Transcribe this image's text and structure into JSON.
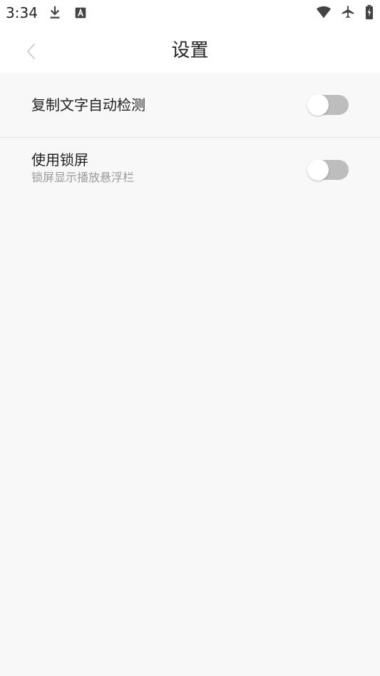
{
  "status_bar": {
    "time": "3:34",
    "left_icons": [
      "download-icon",
      "font-icon"
    ],
    "right_icons": [
      "wifi-icon",
      "airplane-icon",
      "battery-icon"
    ]
  },
  "header": {
    "title": "设置",
    "back_icon": "chevron-left-icon"
  },
  "settings": [
    {
      "label": "复制文字自动检测",
      "subtitle": "",
      "enabled": false
    },
    {
      "label": "使用锁屏",
      "subtitle": "锁屏显示播放悬浮栏",
      "enabled": false
    }
  ],
  "colors": {
    "background": "#f8f8f8",
    "toggle_track_off": "#bdbdbd",
    "toggle_knob": "#ffffff",
    "subtitle": "#9a9a9a",
    "divider": "#e3e3e3"
  }
}
